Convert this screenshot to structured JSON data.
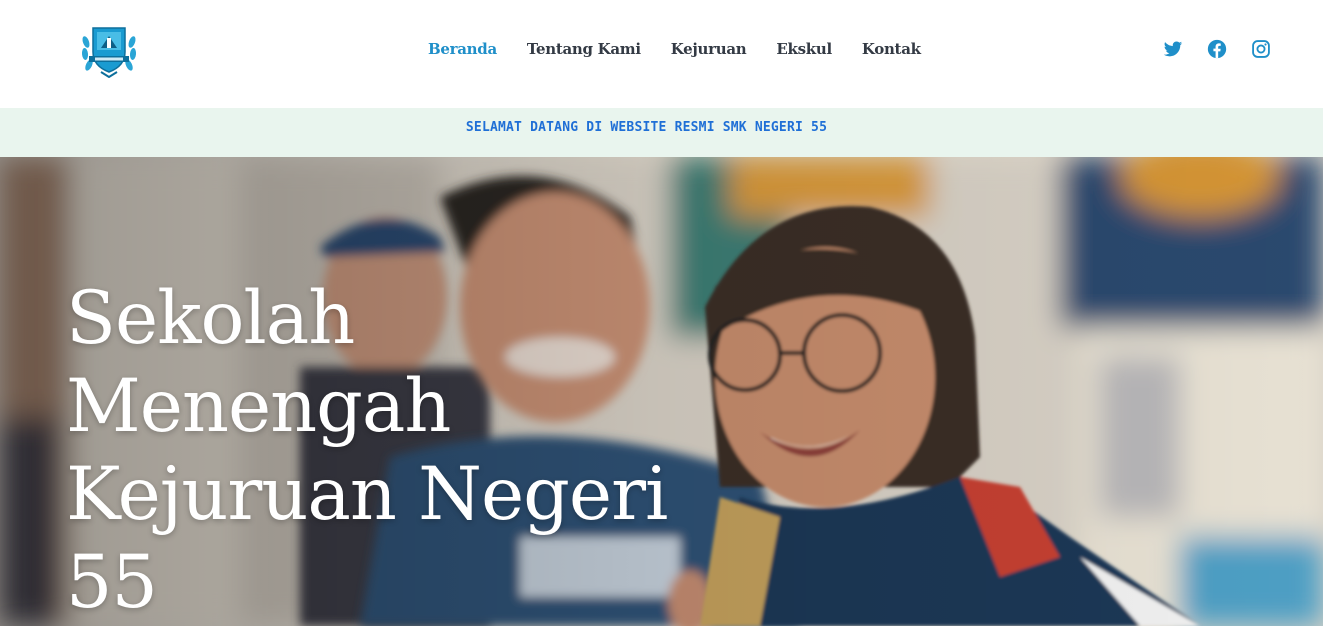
{
  "nav": {
    "logo_icon": "school-crest-icon",
    "links": [
      {
        "label": "Beranda",
        "active": true
      },
      {
        "label": "Tentang Kami",
        "active": false
      },
      {
        "label": "Kejuruan",
        "active": false
      },
      {
        "label": "Ekskul",
        "active": false
      },
      {
        "label": "Kontak",
        "active": false
      }
    ],
    "socials": [
      "twitter-icon",
      "facebook-icon",
      "instagram-icon"
    ]
  },
  "banner": {
    "text": "SELAMAT DATANG DI WEBSITE RESMI SMK NEGERI 55"
  },
  "hero": {
    "title": "Sekolah Menengah Kejuruan Negeri 55"
  },
  "colors": {
    "accent": "#1f8fc9",
    "nav_text": "#333a44",
    "banner_bg": "#e9f5ee",
    "banner_text": "#1f6fd6",
    "social": "#1f8fc9"
  }
}
